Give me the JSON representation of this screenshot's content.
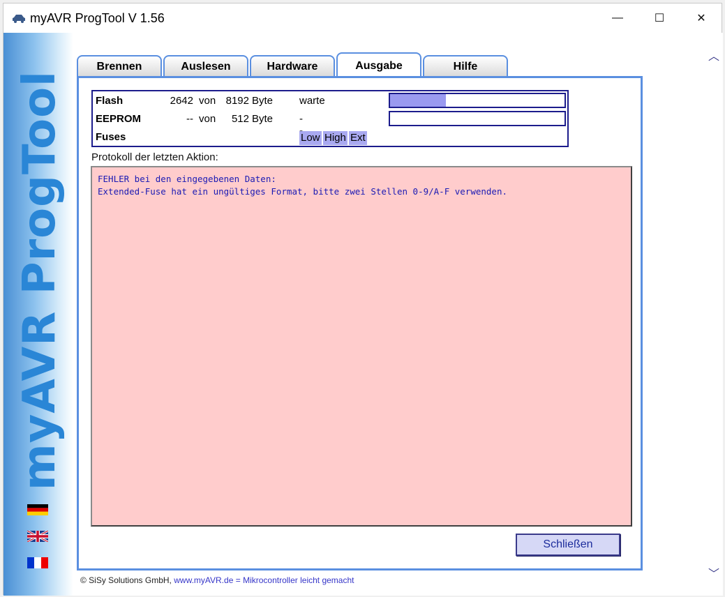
{
  "window": {
    "title": "myAVR ProgTool V 1.56",
    "minimize": "—",
    "maximize": "☐",
    "close": "✕"
  },
  "sidebar": {
    "brand": "myAVR ProgTool"
  },
  "tabs": [
    {
      "label": "Brennen"
    },
    {
      "label": "Auslesen"
    },
    {
      "label": "Hardware"
    },
    {
      "label": "Ausgabe",
      "active": true
    },
    {
      "label": "Hilfe"
    }
  ],
  "status": {
    "flash": {
      "label": "Flash",
      "used": "2642",
      "of": "von",
      "total": "8192",
      "unit": "Byte",
      "state": "warte",
      "progress": 0.32
    },
    "eeprom": {
      "label": "EEPROM",
      "used": "--",
      "of": "von",
      "total": "512",
      "unit": "Byte",
      "state": "--",
      "progress": 0
    },
    "fuses": {
      "label": "Fuses",
      "low": "Low",
      "high": "High",
      "ext": "Ext"
    }
  },
  "protocol": {
    "label": "Protokoll der letzten Aktion:",
    "log": "FEHLER bei den eingegebenen Daten:\nExtended-Fuse hat ein ungültiges Format, bitte zwei Stellen 0-9/A-F verwenden."
  },
  "buttons": {
    "close": "Schließen"
  },
  "footer": {
    "copyright": "© SiSy Solutions GmbH,",
    "url": "www.myAVR.de",
    "sep": "=",
    "slogan": "Mikrocontroller leicht gemacht"
  },
  "colors": {
    "accent": "#5a8fe0",
    "log_bg": "#ffcccc",
    "log_text": "#1a1ab4",
    "progress": "#9a9af0"
  }
}
